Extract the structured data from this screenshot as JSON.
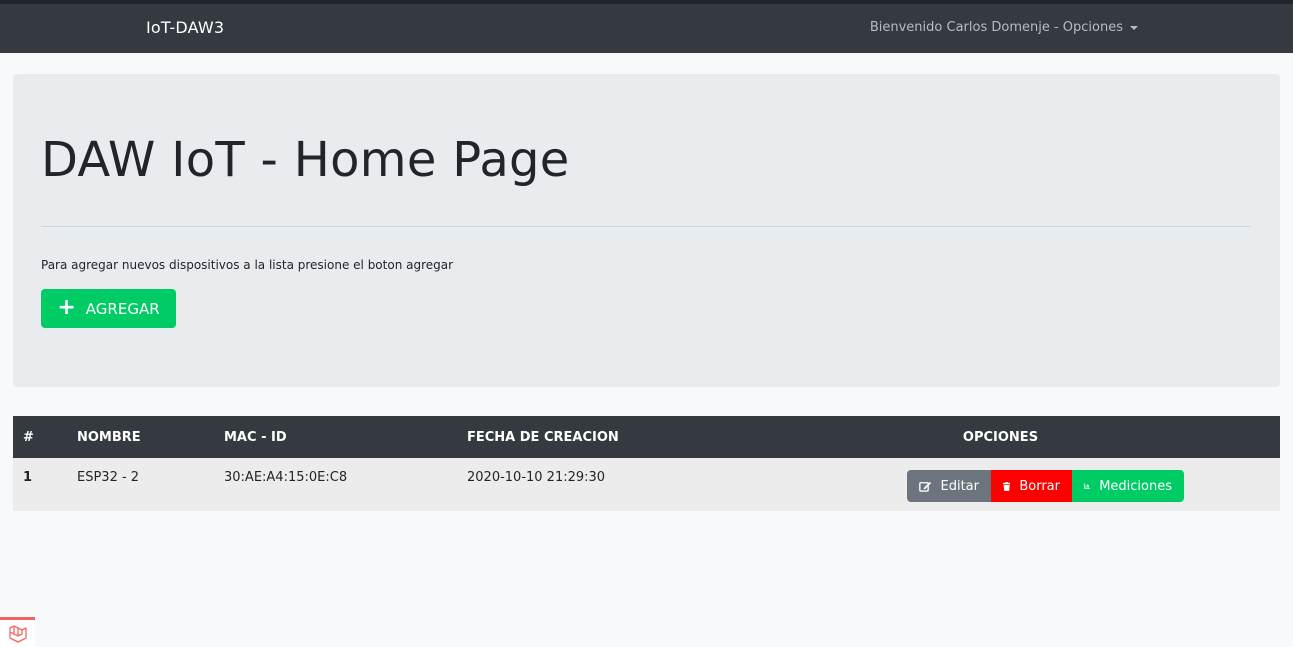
{
  "navbar": {
    "brand": "IoT-DAW3",
    "user_menu": "Bienvenido Carlos Domenje - Opciones"
  },
  "jumbotron": {
    "title": "DAW IoT - Home Page",
    "description": "Para agregar nuevos dispositivos a la lista presione el boton agregar",
    "add_button": "AGREGAR"
  },
  "table": {
    "headers": [
      "#",
      "NOMBRE",
      "MAC - ID",
      "FECHA DE CREACION",
      "OPCIONES"
    ],
    "rows": [
      {
        "num": "1",
        "nombre": "ESP32 - 2",
        "mac": "30:AE:A4:15:0E:C8",
        "fecha": "2020-10-10 21:29:30",
        "edit_label": "Editar",
        "delete_label": "Borrar",
        "measurements_label": "Mediciones"
      }
    ]
  },
  "colors": {
    "navbar": "#343a40",
    "success": "#00cc66",
    "danger": "#ff0000",
    "secondary": "#6c757d"
  },
  "icons": {
    "add": "plus-icon",
    "edit": "edit-icon",
    "delete": "trash-icon",
    "measurements": "bar-chart-icon",
    "badge": "laravel-icon"
  }
}
